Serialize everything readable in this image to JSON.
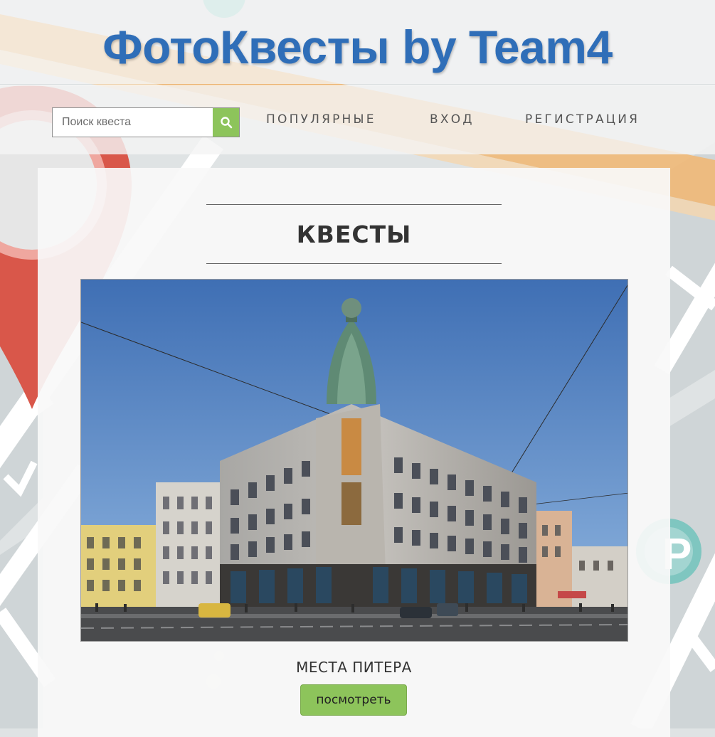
{
  "header": {
    "logo": "ФотоКвесты by Team4"
  },
  "search": {
    "placeholder": "Поиск квеста",
    "value": "",
    "icon": "search-icon"
  },
  "nav": {
    "popular": "ПОПУЛЯРНЫЕ",
    "login": "ВХОД",
    "register": "РЕГИСТРАЦИЯ"
  },
  "main": {
    "section_title": "КВЕСТЫ",
    "quests": [
      {
        "name": "МЕСТА ПИТЕРА",
        "view_label": "посмотреть"
      }
    ]
  },
  "map_markers": {
    "parking_label": "P"
  },
  "colors": {
    "logo": "#2f6eb8",
    "accent_green": "#8dc45b",
    "pin_red": "#d9574a",
    "parking_teal": "#7fc6c0",
    "road_orange": "#f0b877"
  }
}
